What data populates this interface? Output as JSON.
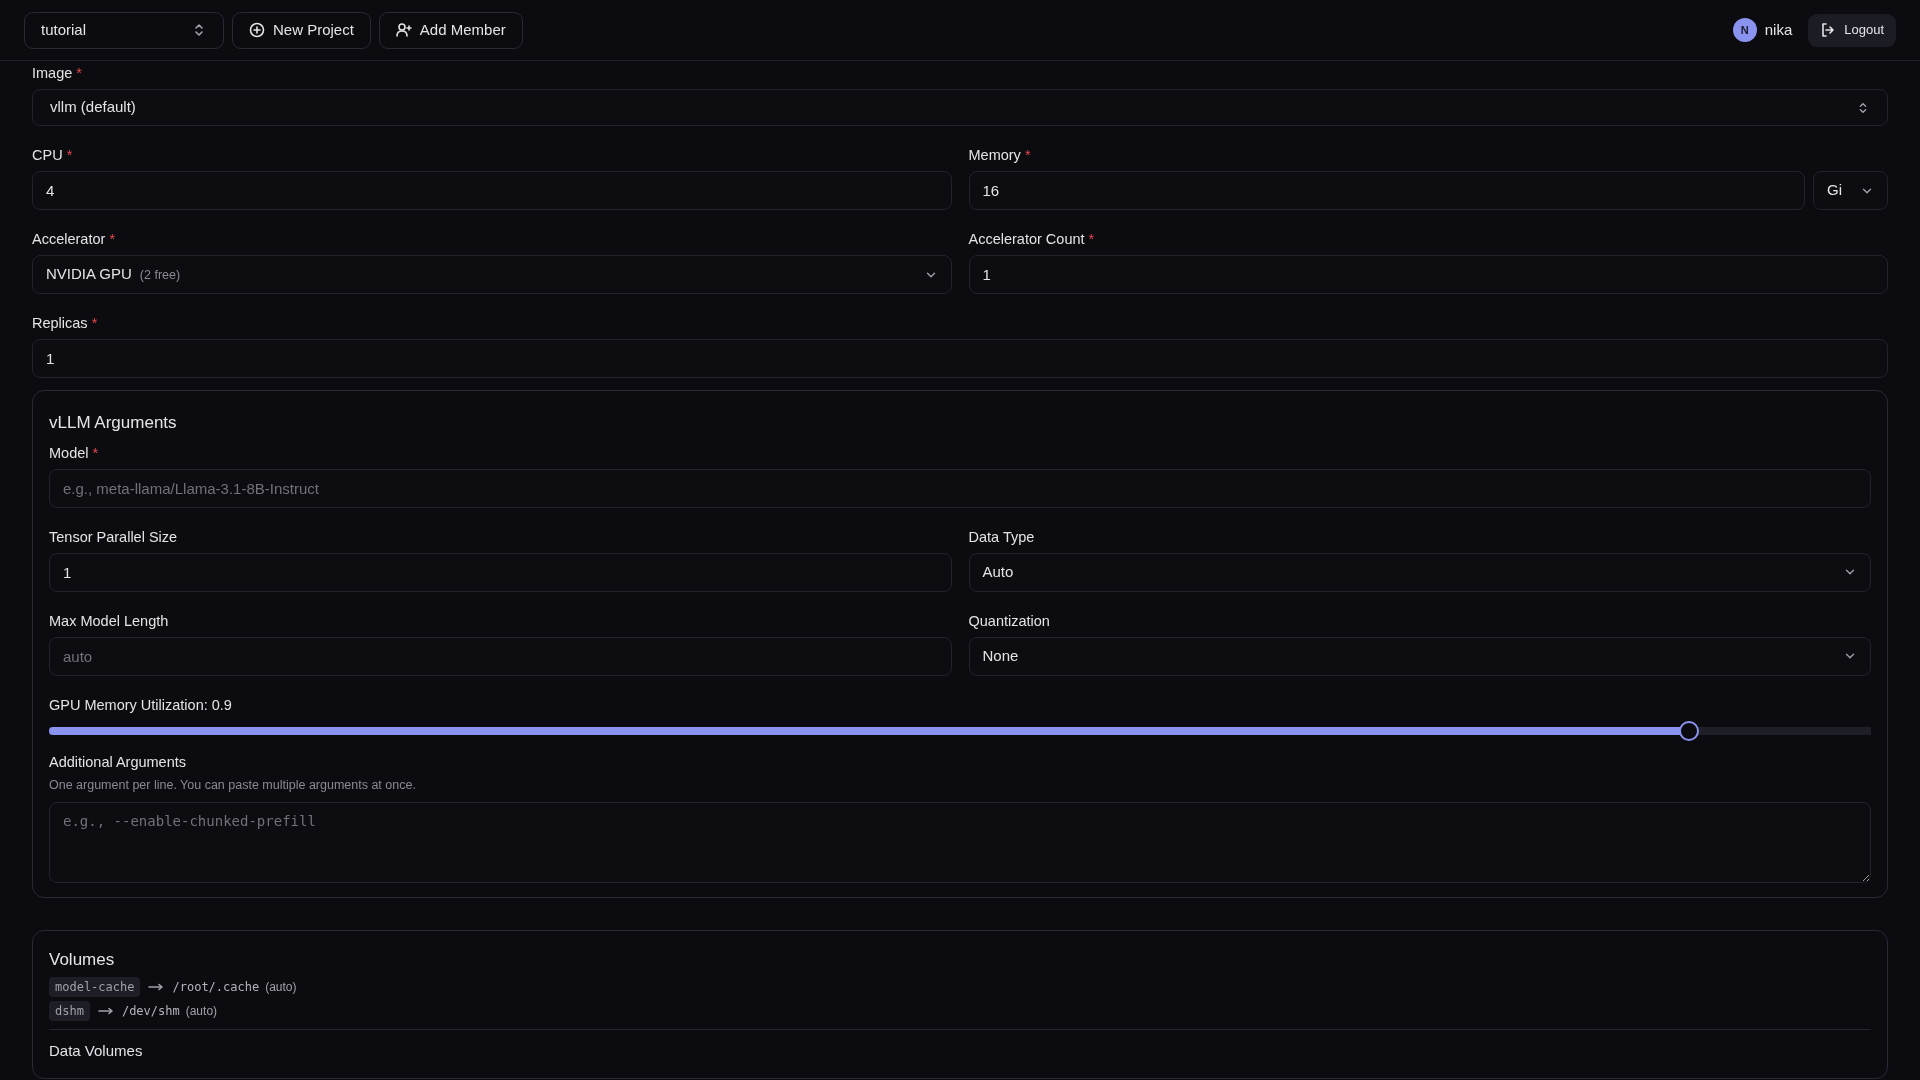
{
  "header": {
    "project": "tutorial",
    "buttons": [
      {
        "label": "New Project"
      },
      {
        "label": "Add Member"
      }
    ],
    "user": {
      "initial": "N",
      "name": "nika"
    },
    "logout": "Logout"
  },
  "form": {
    "rows": [
      [
        {
          "kind": "picker",
          "label": "Image",
          "marker": "*",
          "value": "vllm (default)"
        }
      ],
      [
        {
          "kind": "input",
          "label": "CPU",
          "marker": "*",
          "value": "4"
        },
        {
          "kind": "unit-input",
          "label": "Memory",
          "marker": "*",
          "value": "16",
          "unit": "Gi"
        }
      ],
      [
        {
          "kind": "select",
          "label": "Accelerator",
          "marker": "*",
          "value": "NVIDIA GPU",
          "note": "(2 free)"
        },
        {
          "kind": "input",
          "label": "Accelerator Count",
          "marker": "*",
          "value": "1"
        }
      ],
      [
        {
          "kind": "input",
          "label": "Replicas",
          "marker": "*",
          "value": "1"
        }
      ]
    ]
  },
  "vllm": {
    "title": "vLLM Arguments",
    "rows": [
      [
        {
          "kind": "input",
          "label": "Model",
          "marker": "*",
          "placeholder": "e.g., meta-llama/Llama-3.1-8B-Instruct"
        }
      ],
      [
        {
          "kind": "input",
          "label": "Tensor Parallel Size",
          "value": "1"
        },
        {
          "kind": "select",
          "label": "Data Type",
          "value": "Auto"
        }
      ],
      [
        {
          "kind": "input",
          "label": "Max Model Length",
          "placeholder": "auto"
        },
        {
          "kind": "select",
          "label": "Quantization",
          "value": "None"
        }
      ],
      [
        {
          "kind": "slider",
          "label": "GPU Memory Utilization: 0.9",
          "level": 0.9
        }
      ],
      [
        {
          "kind": "textarea",
          "label": "Additional Arguments",
          "help": "One argument per line. You can paste multiple arguments at once.",
          "placeholder": "e.g., --enable-chunked-prefill"
        }
      ]
    ]
  },
  "volumes": {
    "title": "Volumes",
    "items": [
      {
        "name": "model-cache",
        "path": "/root/.cache",
        "note": "(auto)"
      },
      {
        "name": "dshm",
        "path": "/dev/shm",
        "note": "(auto)"
      }
    ],
    "data_volumes_title": "Data Volumes"
  }
}
